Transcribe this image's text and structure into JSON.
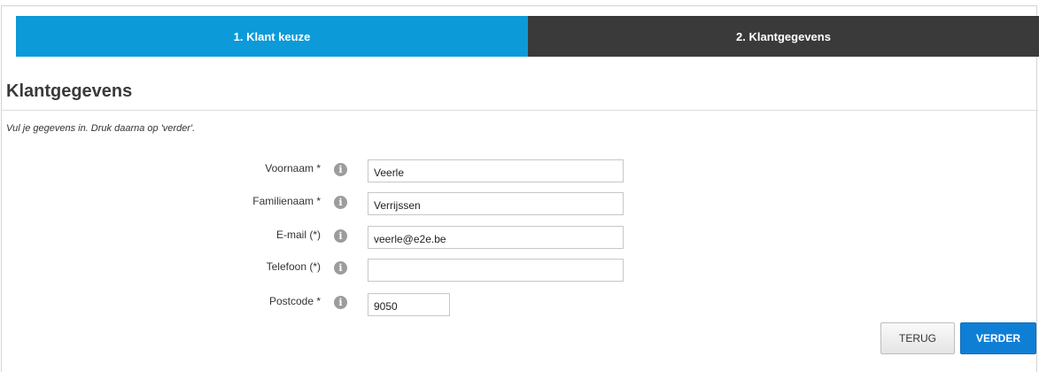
{
  "steps": [
    {
      "label": "1. Klant keuze",
      "active": true
    },
    {
      "label": "2. Klantgegevens",
      "active": false
    }
  ],
  "page": {
    "title": "Klantgegevens",
    "instruction": "Vul je gegevens in. Druk daarna op 'verder'."
  },
  "form": {
    "fields": [
      {
        "label": "Voornaam *",
        "value": "Veerle"
      },
      {
        "label": "Familienaam *",
        "value": "Verrijssen"
      },
      {
        "label": "E-mail (*)",
        "value": "veerle@e2e.be"
      },
      {
        "label": "Telefoon (*)",
        "value": ""
      },
      {
        "label": "Postcode *",
        "value": "9050"
      }
    ],
    "info_icon": "i"
  },
  "buttons": {
    "back_label": "TERUG",
    "next_label": "VERDER"
  },
  "colors": {
    "step_active": "#0c9ad9",
    "step_inactive": "#3a3a3a",
    "primary_button": "#0f7fd6"
  }
}
